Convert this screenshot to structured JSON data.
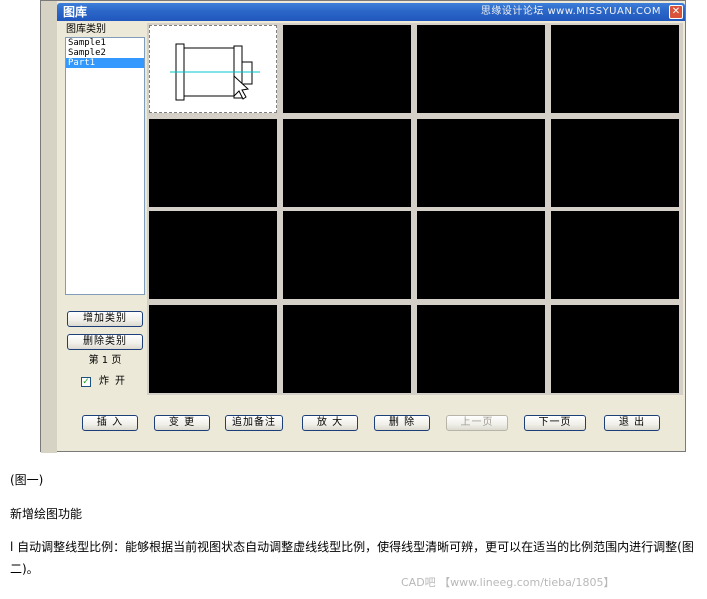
{
  "window": {
    "title": "图库",
    "watermark": "思缘设计论坛 www.MISSYUAN.COM",
    "close_glyph": "✕"
  },
  "category_panel": {
    "label": "图库类别",
    "items": [
      {
        "label": "Sample1",
        "selected": false
      },
      {
        "label": "Sample2",
        "selected": false
      },
      {
        "label": "Part1",
        "selected": true
      }
    ],
    "add_button": "增加类别",
    "delete_button": "删除类别",
    "page_label": "第 1 页",
    "explode_checkbox": {
      "label": "炸开",
      "checked": true
    }
  },
  "toolbar": {
    "insert": "插 入",
    "change": "变 更",
    "add_note": "追加备注",
    "zoom": "放 大",
    "delete": "删 除",
    "prev_page": "上一页",
    "next_page": "下一页",
    "exit": "退 出"
  },
  "colors": {
    "titlebar": "#2b67c8",
    "selection": "#3399ff",
    "cell_bg": "#000000",
    "preview_line": "#00c8c8"
  },
  "caption": {
    "figure": "(图一)",
    "heading": "新增绘图功能",
    "paragraph": "l 自动调整线型比例：能够根据当前视图状态自动调整虚线线型比例，使得线型清晰可辨，更可以在适当的比例范围内进行调整(图二)。",
    "watermark": "CAD吧 【www.lineeg.com/tieba/1805】"
  }
}
